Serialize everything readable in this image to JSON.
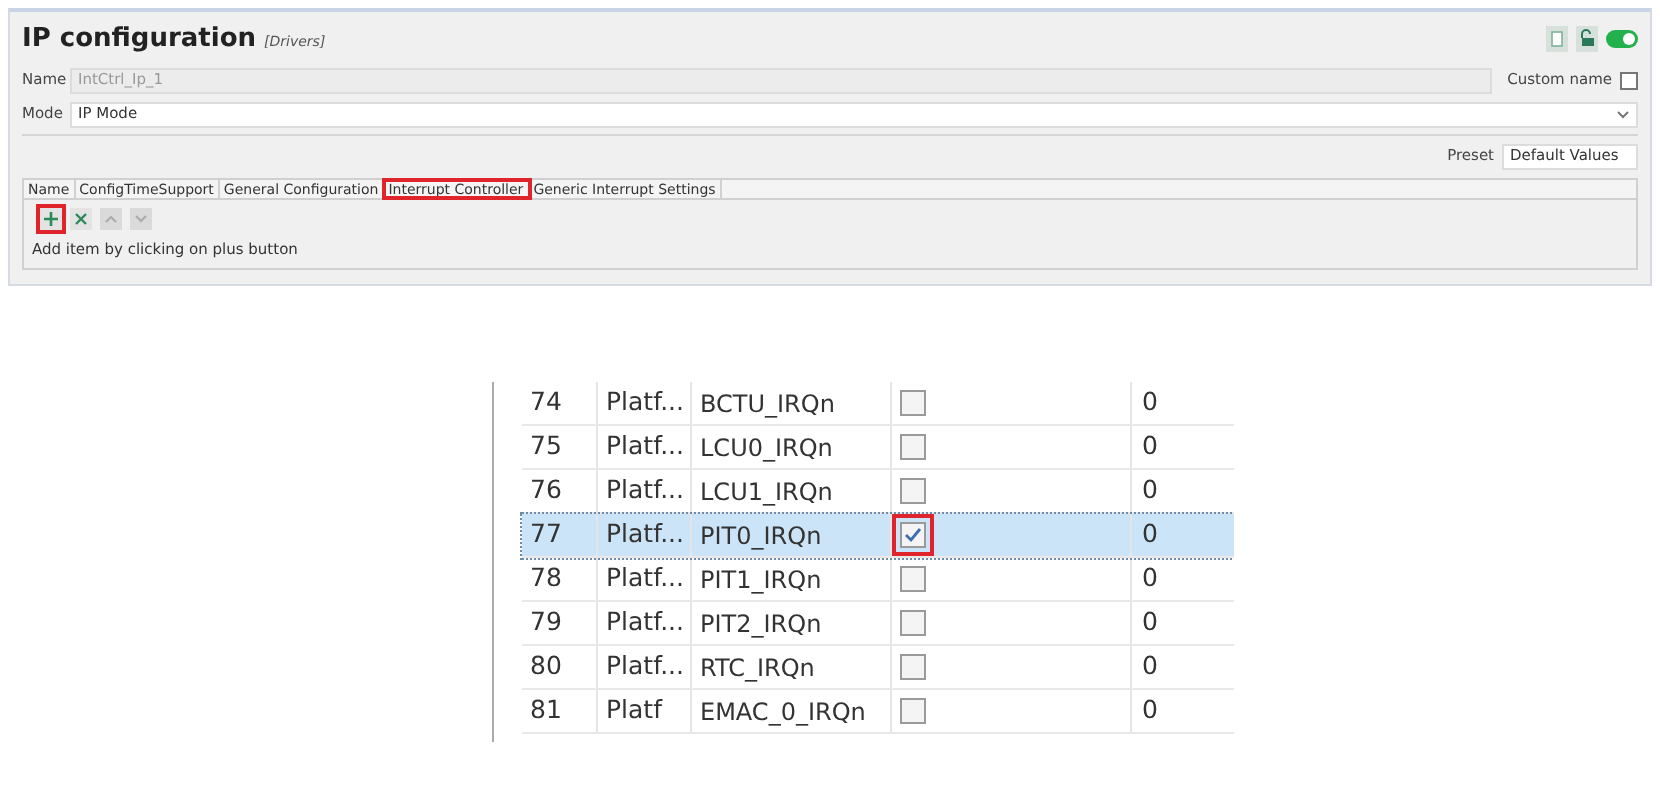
{
  "header": {
    "title": "IP configuration",
    "subtitle": "[Drivers]",
    "toggle_on": true
  },
  "name_row": {
    "label": "Name",
    "value": "IntCtrl_Ip_1",
    "custom_label": "Custom name",
    "custom_checked": false
  },
  "mode_row": {
    "label": "Mode",
    "value": "IP Mode"
  },
  "preset": {
    "label": "Preset",
    "value": "Default Values"
  },
  "tabs": [
    {
      "label": "Name",
      "annotated": false
    },
    {
      "label": "ConfigTimeSupport",
      "annotated": false
    },
    {
      "label": "General Configuration",
      "annotated": false
    },
    {
      "label": "Interrupt Controller",
      "annotated": true
    },
    {
      "label": "Generic Interrupt Settings",
      "annotated": false
    }
  ],
  "toolbar": [
    {
      "kind": "add",
      "annotated": true,
      "disabled": false
    },
    {
      "kind": "remove",
      "annotated": false,
      "disabled": false
    },
    {
      "kind": "up",
      "annotated": false,
      "disabled": true
    },
    {
      "kind": "down",
      "annotated": false,
      "disabled": true
    }
  ],
  "hint": "Add item by clicking on plus button",
  "table": {
    "rows": [
      {
        "number": "74",
        "category": "Platf...",
        "name": "BCTU_IRQn",
        "checked": false,
        "selected": false,
        "annotated": false,
        "value": "0"
      },
      {
        "number": "75",
        "category": "Platf...",
        "name": "LCU0_IRQn",
        "checked": false,
        "selected": false,
        "annotated": false,
        "value": "0"
      },
      {
        "number": "76",
        "category": "Platf...",
        "name": "LCU1_IRQn",
        "checked": false,
        "selected": false,
        "annotated": false,
        "value": "0"
      },
      {
        "number": "77",
        "category": "Platf...",
        "name": "PIT0_IRQn",
        "checked": true,
        "selected": true,
        "annotated": true,
        "value": "0"
      },
      {
        "number": "78",
        "category": "Platf...",
        "name": "PIT1_IRQn",
        "checked": false,
        "selected": false,
        "annotated": false,
        "value": "0"
      },
      {
        "number": "79",
        "category": "Platf...",
        "name": "PIT2_IRQn",
        "checked": false,
        "selected": false,
        "annotated": false,
        "value": "0"
      },
      {
        "number": "80",
        "category": "Platf...",
        "name": "RTC_IRQn",
        "checked": false,
        "selected": false,
        "annotated": false,
        "value": "0"
      },
      {
        "number": "81",
        "category": "Platf",
        "name": "EMAC_0_IRQn",
        "checked": false,
        "selected": false,
        "annotated": false,
        "value": "0"
      }
    ]
  }
}
